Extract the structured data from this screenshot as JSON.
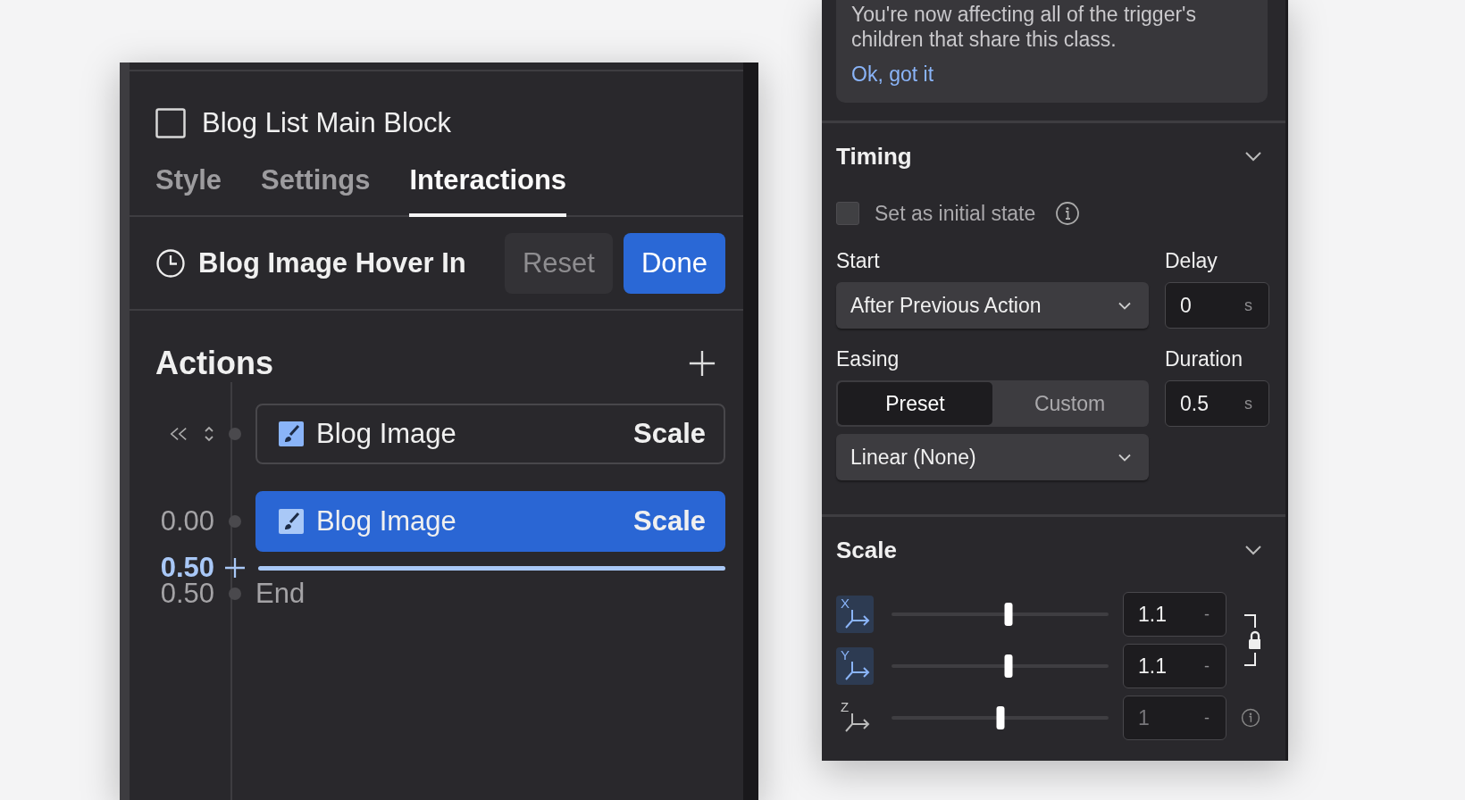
{
  "element": {
    "name": "Blog List Main Block"
  },
  "tabs": [
    {
      "label": "Style",
      "selected": false
    },
    {
      "label": "Settings",
      "selected": false
    },
    {
      "label": "Interactions",
      "selected": true
    }
  ],
  "interaction": {
    "name": "Blog Image Hover In",
    "buttons": [
      {
        "label": "Reset",
        "kind": "secondary"
      },
      {
        "label": "Done",
        "kind": "primary"
      }
    ]
  },
  "actions": {
    "title": "Actions",
    "items": [
      {
        "kind": "action",
        "target": "Blog Image",
        "effect": "Scale",
        "selected": false
      },
      {
        "kind": "action",
        "time": "0.00",
        "target": "Blog Image",
        "effect": "Scale",
        "selected": true
      },
      {
        "kind": "marker",
        "time": "0.50"
      },
      {
        "kind": "end",
        "time": "0.50",
        "label": "End"
      }
    ]
  },
  "notice": {
    "lines": [
      "You're now affecting all of the trigger's",
      "children that share this class."
    ],
    "link": "Ok, got it"
  },
  "timing": {
    "title": "Timing",
    "initial_state": {
      "label": "Set as initial state",
      "checked": false
    },
    "start": {
      "label": "Start",
      "value": "After Previous Action"
    },
    "delay": {
      "label": "Delay",
      "value": "0",
      "unit": "s"
    },
    "easing": {
      "label": "Easing",
      "modes": [
        {
          "label": "Preset",
          "selected": true
        },
        {
          "label": "Custom",
          "selected": false
        }
      ],
      "value": "Linear (None)"
    },
    "duration": {
      "label": "Duration",
      "value": "0.5",
      "unit": "s"
    }
  },
  "scale": {
    "title": "Scale",
    "axes": [
      {
        "axis": "X",
        "level": 0.54,
        "value": "1.1",
        "unit": "-",
        "active": true
      },
      {
        "axis": "Y",
        "level": 0.54,
        "value": "1.1",
        "unit": "-",
        "active": true
      },
      {
        "axis": "Z",
        "level": 0.5,
        "value": "1",
        "unit": "-",
        "active": false
      }
    ]
  }
}
